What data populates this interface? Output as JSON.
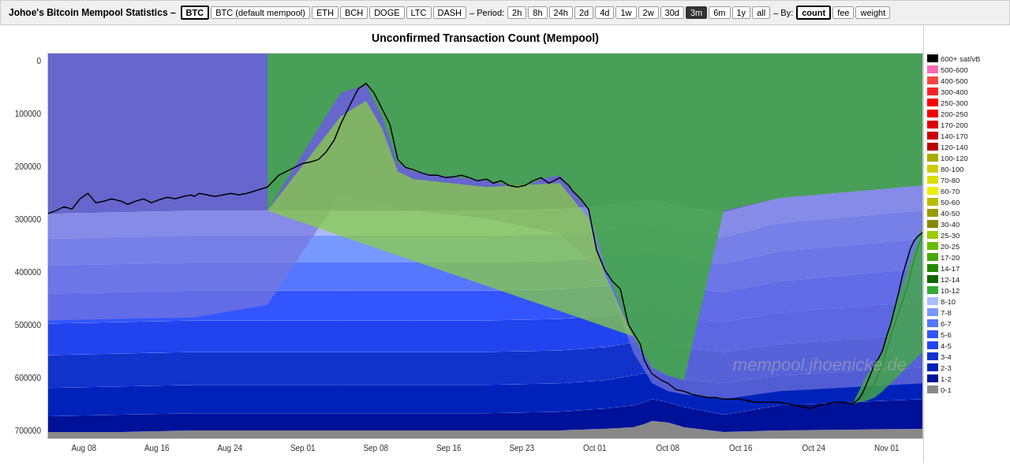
{
  "header": {
    "title": "Johoe's Bitcoin Mempool Statistics –",
    "dash1": "–",
    "period_label": "– Period:",
    "by_label": "– By:",
    "coins": [
      {
        "label": "BTC",
        "active": true
      },
      {
        "label": "BTC (default mempool)",
        "active": false
      },
      {
        "label": "ETH",
        "active": false
      },
      {
        "label": "BCH",
        "active": false
      },
      {
        "label": "DOGE",
        "active": false
      },
      {
        "label": "LTC",
        "active": false
      },
      {
        "label": "DASH",
        "active": false
      }
    ],
    "periods": [
      {
        "label": "2h"
      },
      {
        "label": "8h"
      },
      {
        "label": "24h"
      },
      {
        "label": "2d"
      },
      {
        "label": "4d"
      },
      {
        "label": "1w"
      },
      {
        "label": "2w"
      },
      {
        "label": "30d"
      },
      {
        "label": "3m",
        "active": true
      },
      {
        "label": "6m"
      },
      {
        "label": "1y"
      },
      {
        "label": "all"
      }
    ],
    "by_options": [
      {
        "label": "count",
        "active": true
      },
      {
        "label": "fee"
      },
      {
        "label": "weight"
      }
    ]
  },
  "chart": {
    "title": "Unconfirmed Transaction Count (Mempool)",
    "watermark": "mempool.jhoenicke.de",
    "y_labels": [
      "0",
      "100000",
      "200000",
      "300000",
      "400000",
      "500000",
      "600000",
      "700000"
    ],
    "x_labels": [
      "Aug 08",
      "Aug 16",
      "Aug 24",
      "Sep 01",
      "Sep 08",
      "Sep 16",
      "Sep 23",
      "Oct 01",
      "Oct 08",
      "Oct 16",
      "Oct 24",
      "Nov 01"
    ]
  },
  "legend": {
    "items": [
      {
        "label": "600+ sat/vB",
        "color": "#000000"
      },
      {
        "label": "500-600",
        "color": "#ff69b4"
      },
      {
        "label": "400-500",
        "color": "#ff4444"
      },
      {
        "label": "300-400",
        "color": "#ff2222"
      },
      {
        "label": "250-300",
        "color": "#ff0000"
      },
      {
        "label": "200-250",
        "color": "#ee0000"
      },
      {
        "label": "170-200",
        "color": "#dd0000"
      },
      {
        "label": "140-170",
        "color": "#cc0000"
      },
      {
        "label": "120-140",
        "color": "#bb0000"
      },
      {
        "label": "100-120",
        "color": "#aaaa00"
      },
      {
        "label": "80-100",
        "color": "#cccc00"
      },
      {
        "label": "70-80",
        "color": "#dddd00"
      },
      {
        "label": "60-70",
        "color": "#eeee00"
      },
      {
        "label": "50-60",
        "color": "#bbbb00"
      },
      {
        "label": "40-50",
        "color": "#999900"
      },
      {
        "label": "30-40",
        "color": "#888800"
      },
      {
        "label": "25-30",
        "color": "#99cc00"
      },
      {
        "label": "20-25",
        "color": "#66bb00"
      },
      {
        "label": "17-20",
        "color": "#44aa00"
      },
      {
        "label": "14-17",
        "color": "#228800"
      },
      {
        "label": "12-14",
        "color": "#116600"
      },
      {
        "label": "10-12",
        "color": "#33aa33"
      },
      {
        "label": "8-10",
        "color": "#aabbff"
      },
      {
        "label": "7-8",
        "color": "#7799ff"
      },
      {
        "label": "6-7",
        "color": "#5577ff"
      },
      {
        "label": "5-6",
        "color": "#3355ff"
      },
      {
        "label": "4-5",
        "color": "#2244ee"
      },
      {
        "label": "3-4",
        "color": "#1133cc"
      },
      {
        "label": "2-3",
        "color": "#0022bb"
      },
      {
        "label": "1-2",
        "color": "#001199"
      },
      {
        "label": "0-1",
        "color": "#888888"
      }
    ]
  }
}
